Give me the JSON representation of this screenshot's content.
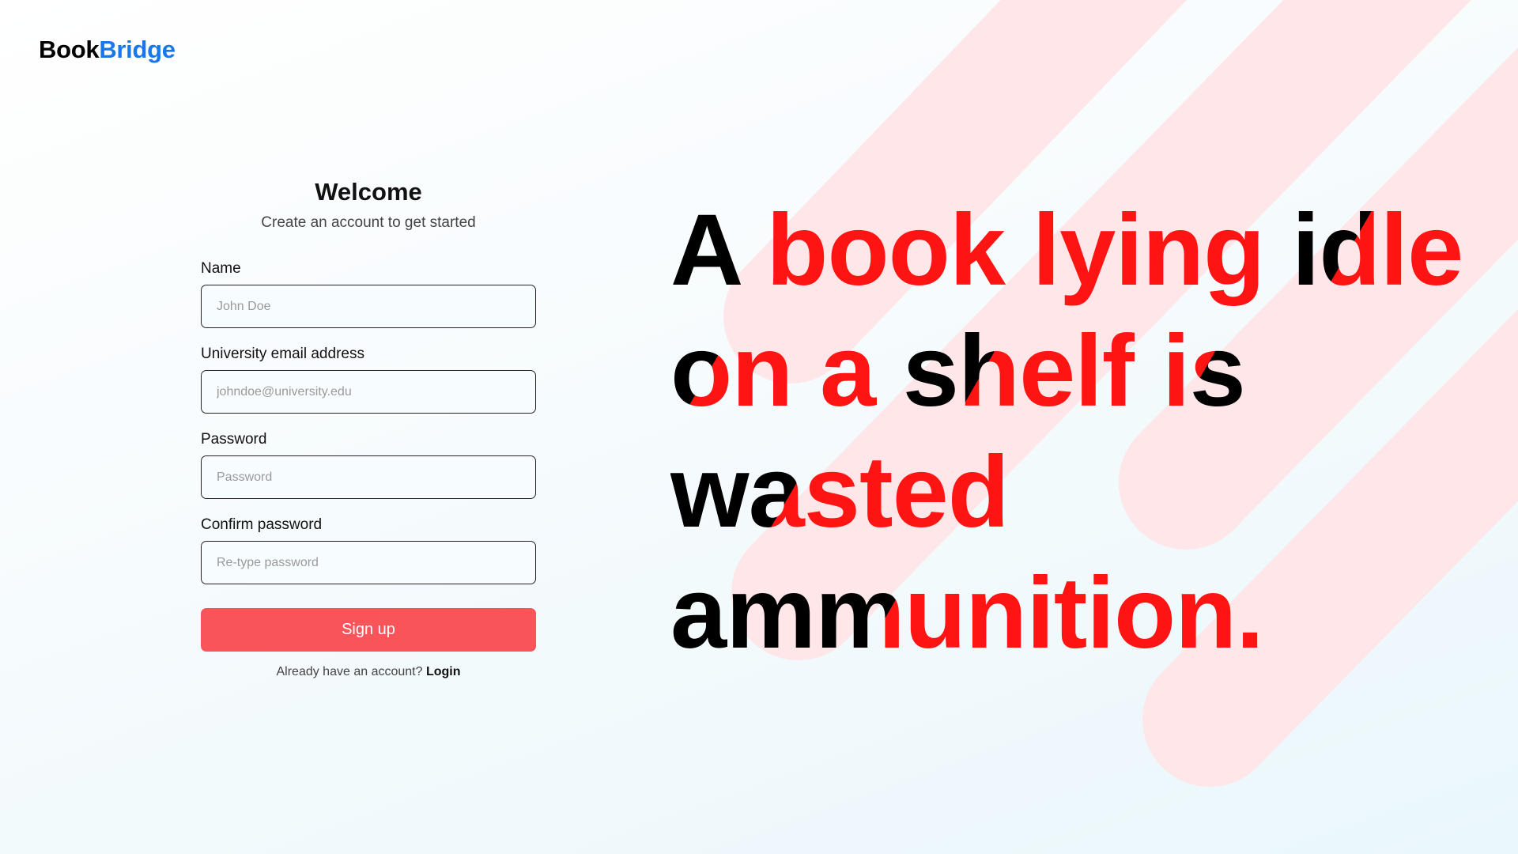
{
  "brand": {
    "name_part1": "Book",
    "name_part2": "Bridge",
    "accent_color": "#1877ea"
  },
  "form": {
    "title": "Welcome",
    "subtitle": "Create an account to get started",
    "fields": [
      {
        "label": "Name",
        "placeholder": "John Doe",
        "value": ""
      },
      {
        "label": "University email address",
        "placeholder": "johndoe@university.edu",
        "value": ""
      },
      {
        "label": "Password",
        "placeholder": "Password",
        "value": ""
      },
      {
        "label": "Confirm password",
        "placeholder": "Re-type password",
        "value": ""
      }
    ],
    "submit_label": "Sign up",
    "submit_color": "#f8545a",
    "already_text": "Already have an account?",
    "login_label": "Login"
  },
  "headline": {
    "words": [
      "A",
      "book",
      "lying",
      "idle",
      "on",
      "a",
      "shelf",
      "is",
      "wasted",
      "ammunition."
    ],
    "red_color": "#ff1414",
    "stripe_color": "#ffe6e8"
  }
}
